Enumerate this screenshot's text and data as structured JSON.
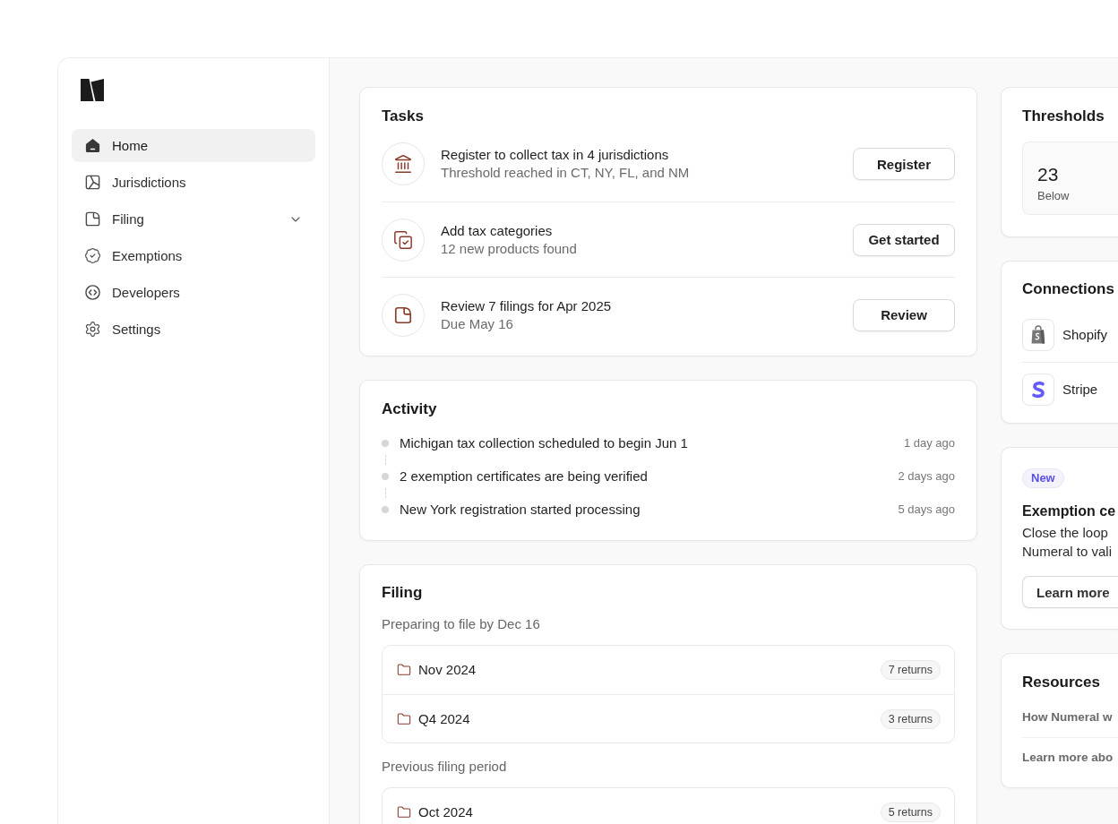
{
  "sidebar": {
    "items": [
      {
        "label": "Home",
        "selected": true,
        "expandable": false
      },
      {
        "label": "Jurisdictions",
        "selected": false,
        "expandable": false
      },
      {
        "label": "Filing",
        "selected": false,
        "expandable": true
      },
      {
        "label": "Exemptions",
        "selected": false,
        "expandable": false
      },
      {
        "label": "Developers",
        "selected": false,
        "expandable": false
      },
      {
        "label": "Settings",
        "selected": false,
        "expandable": false
      }
    ]
  },
  "tasks": {
    "title": "Tasks",
    "items": [
      {
        "title": "Register to collect tax in 4 jurisdictions",
        "subtitle": "Threshold reached in CT, NY, FL, and NM",
        "action": "Register"
      },
      {
        "title": "Add tax categories",
        "subtitle": "12 new products found",
        "action": "Get started"
      },
      {
        "title": "Review 7 filings for Apr 2025",
        "subtitle": "Due May 16",
        "action": "Review"
      }
    ]
  },
  "activity": {
    "title": "Activity",
    "items": [
      {
        "text": "Michigan tax collection scheduled to begin Jun 1",
        "time": "1 day ago"
      },
      {
        "text": "2 exemption certificates are being verified",
        "time": "2 days ago"
      },
      {
        "text": "New York registration started processing",
        "time": "5 days ago"
      }
    ]
  },
  "filing": {
    "title": "Filing",
    "groups": [
      {
        "heading": "Preparing to file by Dec 16",
        "periods": [
          {
            "label": "Nov 2024",
            "returns": "7 returns"
          },
          {
            "label": "Q4 2024",
            "returns": "3 returns"
          }
        ]
      },
      {
        "heading": "Previous filing period",
        "periods": [
          {
            "label": "Oct 2024",
            "returns": "5 returns"
          }
        ]
      }
    ]
  },
  "thresholds": {
    "title": "Thresholds",
    "stats": [
      {
        "value": "23",
        "label": "Below"
      }
    ]
  },
  "connections": {
    "title": "Connections",
    "items": [
      {
        "name": "Shopify"
      },
      {
        "name": "Stripe"
      }
    ]
  },
  "announcement": {
    "badge": "New",
    "title": "Exemption ce",
    "body": [
      "Close the loop",
      "Numeral to vali"
    ],
    "action": "Learn more"
  },
  "resources": {
    "title": "Resources",
    "links": [
      "How Numeral w",
      "Learn more abo"
    ]
  }
}
